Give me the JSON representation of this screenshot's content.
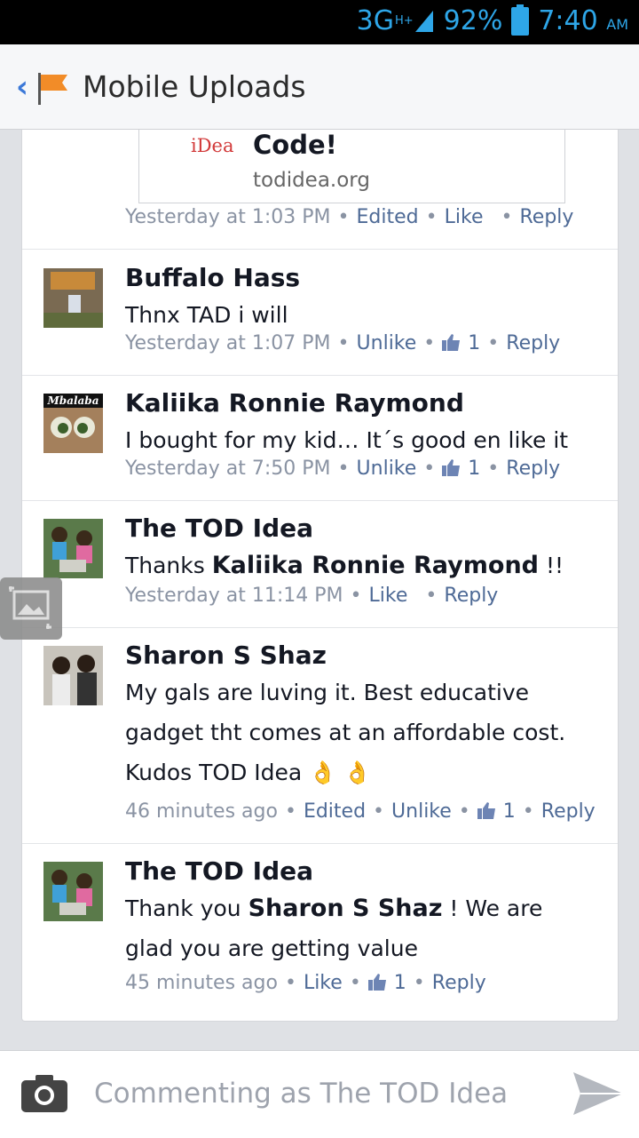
{
  "status": {
    "network": "3G",
    "network_sup": "H+",
    "battery": "92%",
    "time": "7:40",
    "ampm": "AM"
  },
  "appbar": {
    "title": "Mobile Uploads"
  },
  "link_preview": {
    "brand": "iDea",
    "title": "Code!",
    "url": "todidea.org"
  },
  "top_meta": {
    "time": "Yesterday at 1:03 PM",
    "edited": "Edited",
    "like": "Like",
    "reply": "Reply"
  },
  "comments": [
    {
      "author": "Buffalo Hass",
      "text": "Thnx TAD i will",
      "time": "Yesterday at 1:07 PM",
      "like": "Unlike",
      "likes": "1",
      "reply": "Reply"
    },
    {
      "author": "Kaliika Ronnie Raymond",
      "avatar_label": "Mbalaba",
      "text": "I bought for my kid… It´s good en like it",
      "time": "Yesterday at 7:50 PM",
      "like": "Unlike",
      "likes": "1",
      "reply": "Reply"
    },
    {
      "author": "The TOD Idea",
      "text_pre": "Thanks",
      "mention": "Kaliika Ronnie Raymond",
      "text_post": "!!",
      "time": "Yesterday at 11:14 PM",
      "like": "Like",
      "reply": "Reply"
    },
    {
      "author": "Sharon S Shaz",
      "text": "My gals are luving it. Best educative gadget tht comes at an affordable cost. Kudos TOD Idea",
      "time": "46 minutes ago",
      "edited": "Edited",
      "like": "Unlike",
      "likes": "1",
      "reply": "Reply"
    },
    {
      "author": "The TOD Idea",
      "text_pre": "Thank you",
      "mention": "Sharon S Shaz",
      "text_post": "! We are glad you are getting value",
      "time": "45 minutes ago",
      "like": "Like",
      "likes": "1",
      "reply": "Reply"
    }
  ],
  "composer": {
    "placeholder": "Commenting as The TOD Idea"
  }
}
